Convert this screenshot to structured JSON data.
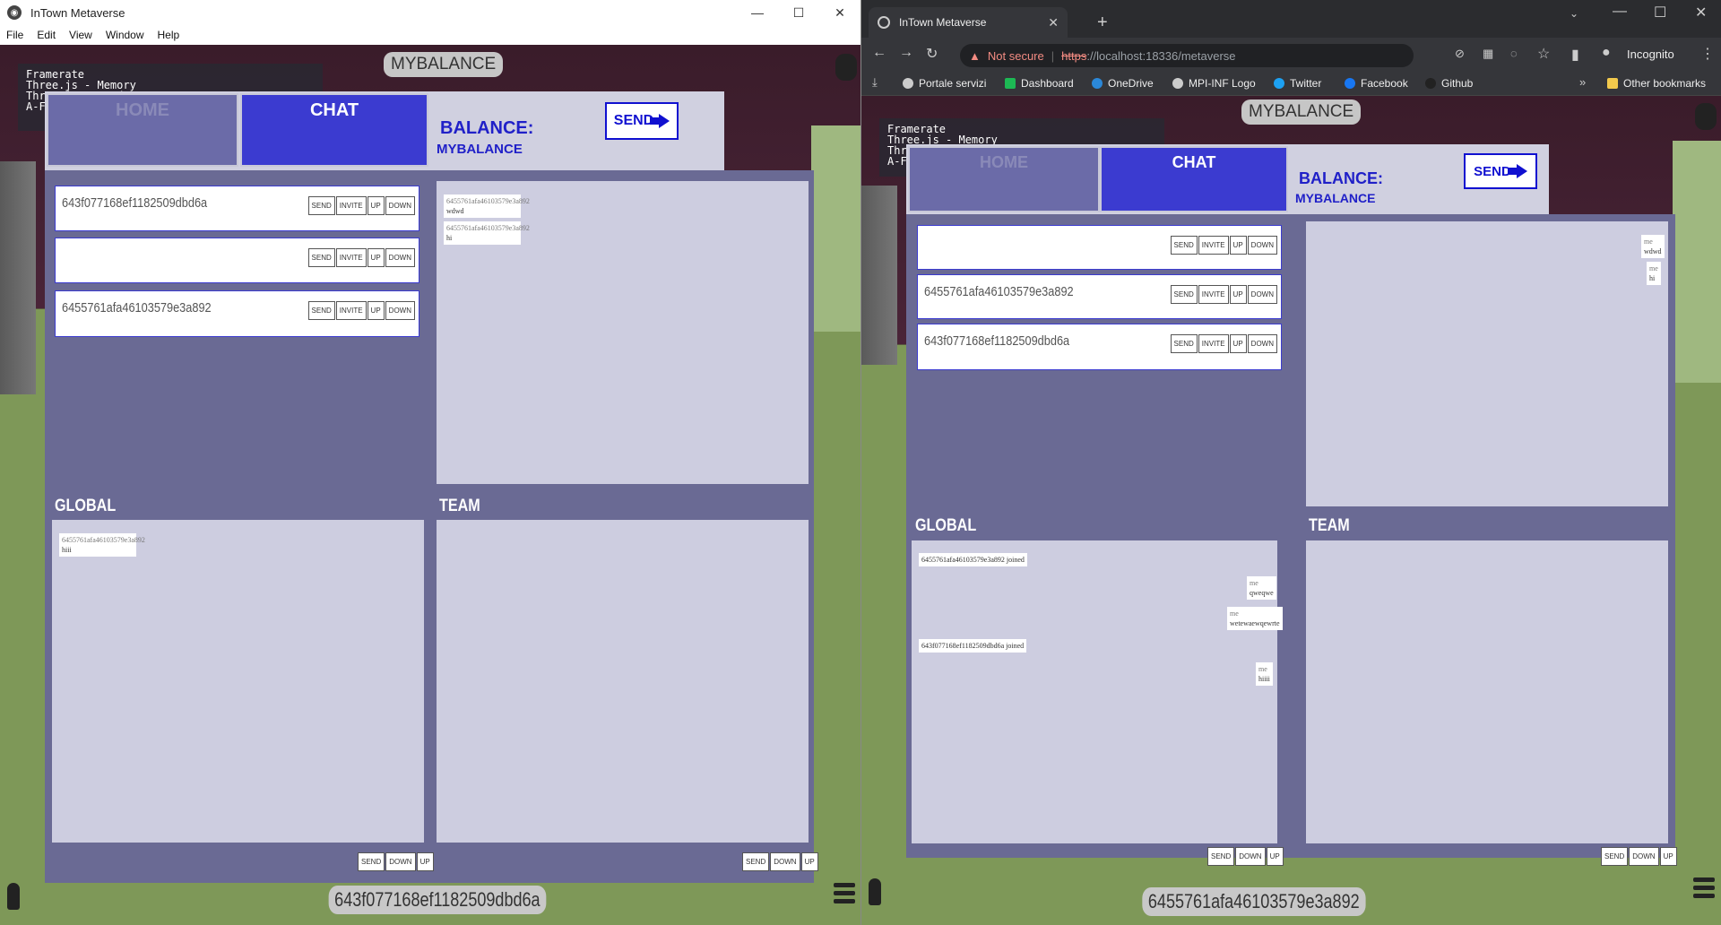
{
  "left_window": {
    "title": "InTown Metaverse",
    "menu": [
      "File",
      "Edit",
      "View",
      "Window",
      "Help"
    ],
    "fps_overlay": "Framerate\nThree.js - Memory\nThree.js - Render\nA-Frame",
    "mybalance_pill": "MYBALANCE",
    "tabs": {
      "home": "HOME",
      "chat": "CHAT"
    },
    "balance_label": "BALANCE:",
    "balance_value": "MYBALANCE",
    "send_label": "SEND",
    "contacts": [
      {
        "id": "643f077168ef1182509dbd6a",
        "buttons": [
          "SEND",
          "INVITE",
          "UP",
          "DOWN"
        ]
      },
      {
        "id": "",
        "buttons": [
          "SEND",
          "INVITE",
          "UP",
          "DOWN"
        ]
      },
      {
        "id": "6455761afa46103579e3a892",
        "buttons": [
          "SEND",
          "INVITE",
          "UP",
          "DOWN"
        ]
      }
    ],
    "private_messages": [
      {
        "sender": "6455761afa46103579e3a892",
        "text": "wdwd"
      },
      {
        "sender": "6455761afa46103579e3a892",
        "text": "hi"
      }
    ],
    "global_label": "GLOBAL",
    "team_label": "TEAM",
    "global_messages": [
      {
        "sender": "6455761afa46103579e3a892",
        "text": "hiii"
      }
    ],
    "global_buttons": [
      "SEND",
      "DOWN",
      "UP"
    ],
    "team_buttons": [
      "SEND",
      "DOWN",
      "UP"
    ],
    "user_id": "643f077168ef1182509dbd6a"
  },
  "right_window": {
    "tab_title": "InTown Metaverse",
    "not_secure": "Not secure",
    "url_scheme": "https",
    "url_rest": "://localhost:18336/metaverse",
    "incognito": "Incognito",
    "bookmarks": [
      "Portale servizi",
      "Dashboard",
      "OneDrive",
      "MPI-INF Logo",
      "Twitter",
      "Facebook",
      "Github"
    ],
    "other_bookmarks": "Other bookmarks",
    "fps_overlay": "Framerate\nThree.js - Memory\nThree.js - Render\nA-Frame",
    "mybalance_pill": "MYBALANCE",
    "tabs": {
      "home": "HOME",
      "chat": "CHAT"
    },
    "balance_label": "BALANCE:",
    "balance_value": "MYBALANCE",
    "send_label": "SEND",
    "contacts": [
      {
        "id": "",
        "buttons": [
          "SEND",
          "INVITE",
          "UP",
          "DOWN"
        ]
      },
      {
        "id": "6455761afa46103579e3a892",
        "buttons": [
          "SEND",
          "INVITE",
          "UP",
          "DOWN"
        ]
      },
      {
        "id": "643f077168ef1182509dbd6a",
        "buttons": [
          "SEND",
          "INVITE",
          "UP",
          "DOWN"
        ]
      }
    ],
    "private_messages": [
      {
        "sender": "me",
        "text": "wdwd"
      },
      {
        "sender": "me",
        "text": "hi"
      }
    ],
    "global_label": "GLOBAL",
    "team_label": "TEAM",
    "global_messages": [
      {
        "sender": "",
        "text": "6455761afa46103579e3a892 joined"
      },
      {
        "sender": "me",
        "text": "qweqwe"
      },
      {
        "sender": "me",
        "text": "wetewaewqewrte"
      },
      {
        "sender": "",
        "text": "643f077168ef1182509dbd6a joined"
      },
      {
        "sender": "me",
        "text": "hiiii"
      }
    ],
    "global_buttons": [
      "SEND",
      "DOWN",
      "UP"
    ],
    "team_buttons": [
      "SEND",
      "DOWN",
      "UP"
    ],
    "user_id": "6455761afa46103579e3a892"
  },
  "colors": {
    "panel_bg": "#6a6a94",
    "chat_tab": "#3b3bd0",
    "accent_blue": "#1010d0",
    "chatbox_bg": "#cdcde0"
  }
}
